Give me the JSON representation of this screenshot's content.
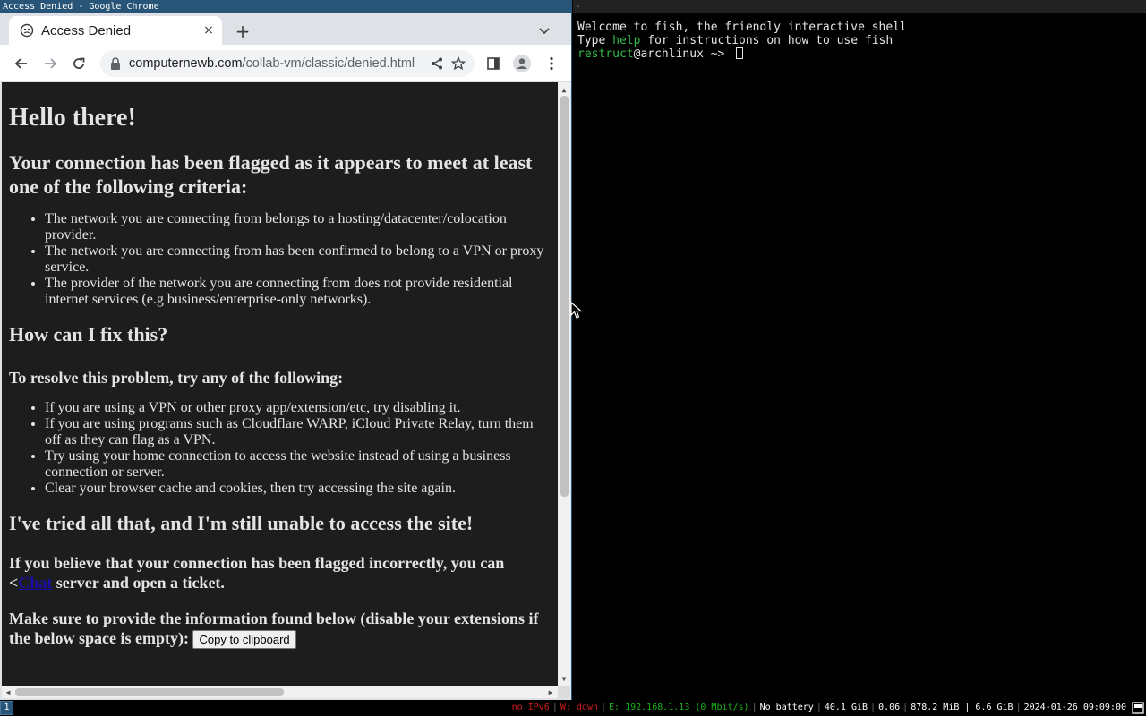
{
  "wm": {
    "left_title": "Access Denied - Google Chrome",
    "right_title": "-",
    "workspace": "1"
  },
  "browser": {
    "tab_title": "Access Denied",
    "tab_close": "×",
    "new_tab": "+",
    "url_host": "computernewb.com",
    "url_path": "/collab-vm/classic/denied.html"
  },
  "page": {
    "h1": "Hello there!",
    "flag_heading": "Your connection has been flagged as it appears to meet at least one of the following criteria:",
    "criteria": [
      "The network you are connecting from belongs to a hosting/datacenter/colocation provider.",
      "The network you are connecting from has been confirmed to belong to a VPN or proxy service.",
      "The provider of the network you are connecting from does not provide residential internet services (e.g business/enterprise-only networks)."
    ],
    "fix_heading": "How can I fix this?",
    "resolve_heading": "To resolve this problem, try any of the following:",
    "fixes": [
      "If you are using a VPN or other proxy app/extension/etc, try disabling it.",
      "If you are using programs such as Cloudflare WARP, iCloud Private Relay, turn them off as they can flag as a VPN.",
      "Try using your home connection to access the website instead of using a business connection or server.",
      "Clear your browser cache and cookies, then try accessing the site again."
    ],
    "tried_heading": "I've tried all that, and I'm still unable to access the site!",
    "believe_pre": "If you believe that your connection has been flagged incorrectly, you can <",
    "chat_link": "Chat",
    "believe_post": " server and open a ticket.",
    "info_text": "Make sure to provide the information found below (disable your extensions if the below space is empty):",
    "copy_button": "Copy to clipboard"
  },
  "terminal": {
    "welcome": "Welcome to fish, the friendly interactive shell",
    "type_word": "Type ",
    "help_word": "help",
    "help_rest": " for instructions on how to use fish",
    "prompt_user": "restruct",
    "prompt_host": "@archlinux",
    "prompt_tail": " ~> "
  },
  "statusbar": {
    "ipv6": "no IPv6",
    "wifi": "W: down",
    "ethernet": "E: 192.168.1.13 (0 Mbit/s)",
    "battery": "No battery",
    "disk": "40.1 GiB",
    "load": "0.06",
    "mem": "878.2 MiB | 6.6 GiB",
    "datetime": "2024-01-26 09:09:00"
  }
}
